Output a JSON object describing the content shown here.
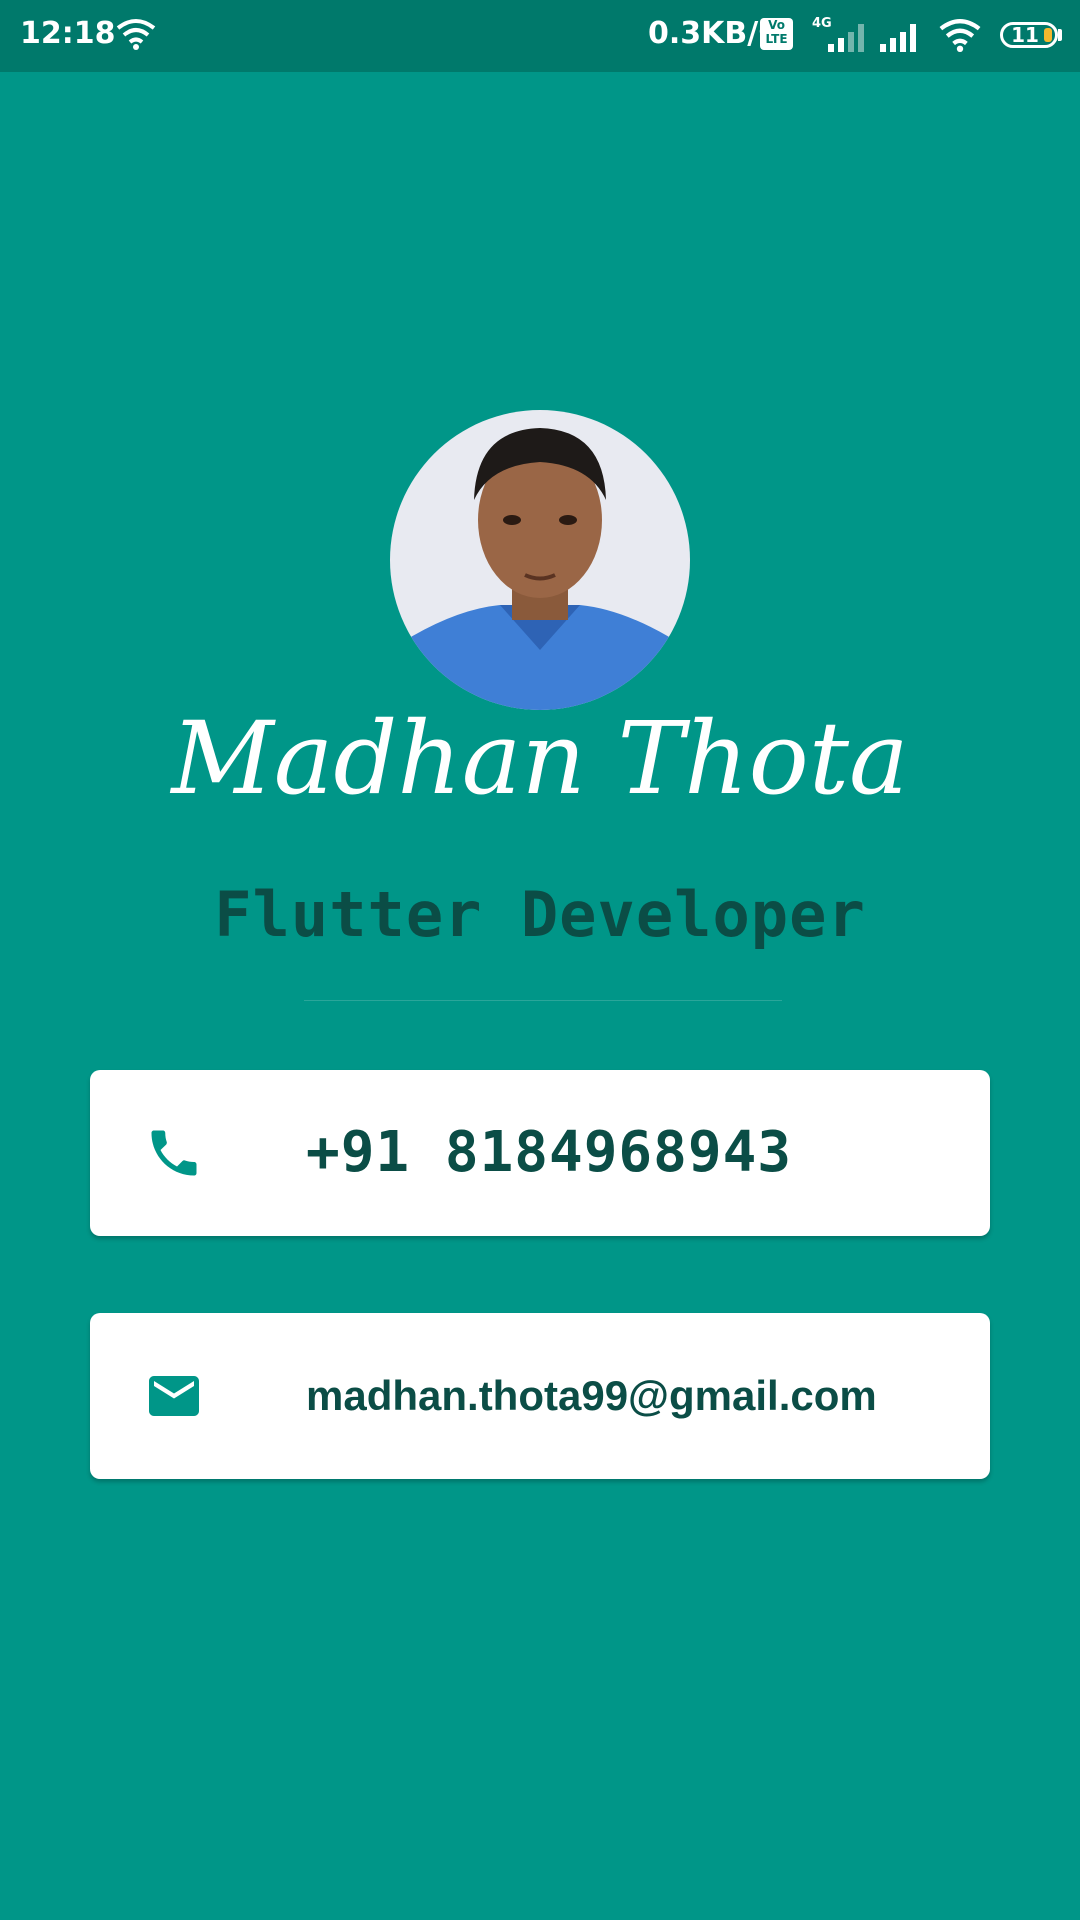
{
  "status_bar": {
    "time": "12:18",
    "network_speed": "0.3KB/s",
    "volte": "Vo LTE",
    "network_type": "4G",
    "battery_level": "11"
  },
  "profile": {
    "name": "Madhan Thota",
    "title": "Flutter Developer"
  },
  "contacts": {
    "phone": "+91 8184968943",
    "email": "madhan.thota99@gmail.com"
  },
  "colors": {
    "background": "#009688",
    "status_bar": "#00796B",
    "text_dark": "#0B4D46",
    "card": "#FFFFFF"
  },
  "icons": {
    "phone": "phone-icon",
    "email": "email-icon"
  }
}
